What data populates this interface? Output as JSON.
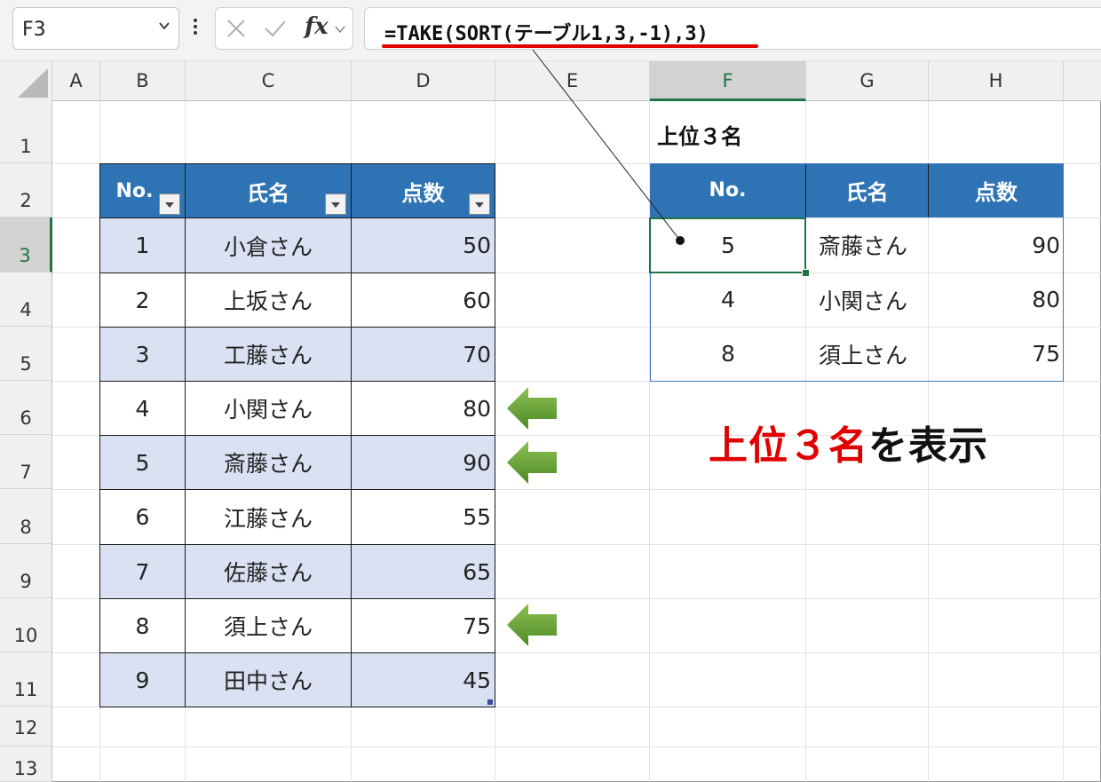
{
  "name_box": {
    "value": "F3"
  },
  "formula_bar": {
    "formula": "=TAKE(SORT(テーブル1,3,-1),3)",
    "cancel_icon": "cancel-x-icon",
    "enter_icon": "checkmark-icon",
    "fx_label": "fx"
  },
  "columns": [
    "A",
    "B",
    "C",
    "D",
    "E",
    "F",
    "G",
    "H"
  ],
  "rows": [
    "1",
    "2",
    "3",
    "4",
    "5",
    "6",
    "7",
    "8",
    "9",
    "10",
    "11",
    "12",
    "13"
  ],
  "source_table": {
    "headers": [
      "No.",
      "氏名",
      "点数"
    ],
    "rows": [
      [
        "1",
        "小倉さん",
        "50"
      ],
      [
        "2",
        "上坂さん",
        "60"
      ],
      [
        "3",
        "工藤さん",
        "70"
      ],
      [
        "4",
        "小関さん",
        "80"
      ],
      [
        "5",
        "斎藤さん",
        "90"
      ],
      [
        "6",
        "江藤さん",
        "55"
      ],
      [
        "7",
        "佐藤さん",
        "65"
      ],
      [
        "8",
        "須上さん",
        "75"
      ],
      [
        "9",
        "田中さん",
        "45"
      ]
    ],
    "header_color": "#2e74b5",
    "band_color": "#d9e1f2"
  },
  "result": {
    "title": "上位３名",
    "headers": [
      "No.",
      "氏名",
      "点数"
    ],
    "rows": [
      [
        "5",
        "斎藤さん",
        "90"
      ],
      [
        "4",
        "小関さん",
        "80"
      ],
      [
        "8",
        "須上さん",
        "75"
      ]
    ]
  },
  "annotation": {
    "caption_red": "上位３名",
    "caption_black": "を表示",
    "accent_red": "#e00000",
    "arrow_color": "#70ad47"
  }
}
